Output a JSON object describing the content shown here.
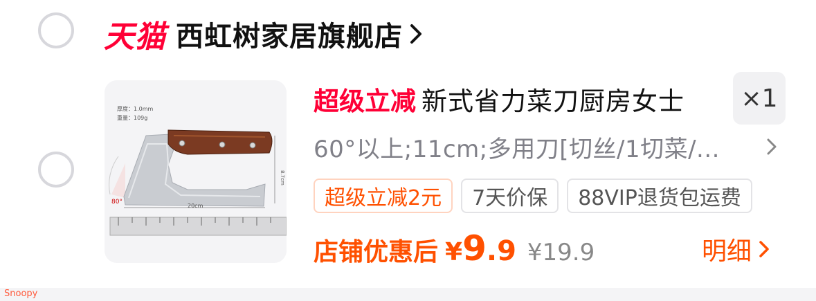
{
  "shop": {
    "logo_text": "天猫",
    "name": "西虹树家居旗舰店"
  },
  "item": {
    "promo_tag": "超级立减",
    "title": "新式省力菜刀厨房女士",
    "quantity": "×1",
    "sku": "60°以上;11cm;多用刀[切丝/1切菜/...",
    "thumbnail_labels": {
      "thickness": "厚度：1.0mm",
      "weight": "重量：109g",
      "angle": "80°",
      "length": "20cm",
      "height": "8.7cm"
    },
    "tags": [
      "超级立减2元",
      "7天价保",
      "88VIP退货包运费"
    ],
    "price_label": "店铺优惠后",
    "price_symbol": "¥",
    "price_integer": "9",
    "price_decimal": ".9",
    "original_price": "¥19.9",
    "detail_label": "明细"
  },
  "footer": {
    "watermark": "Snoopy"
  },
  "colors": {
    "tmall_red": "#ff0036",
    "orange": "#ff5000",
    "gray_text": "#808088"
  }
}
